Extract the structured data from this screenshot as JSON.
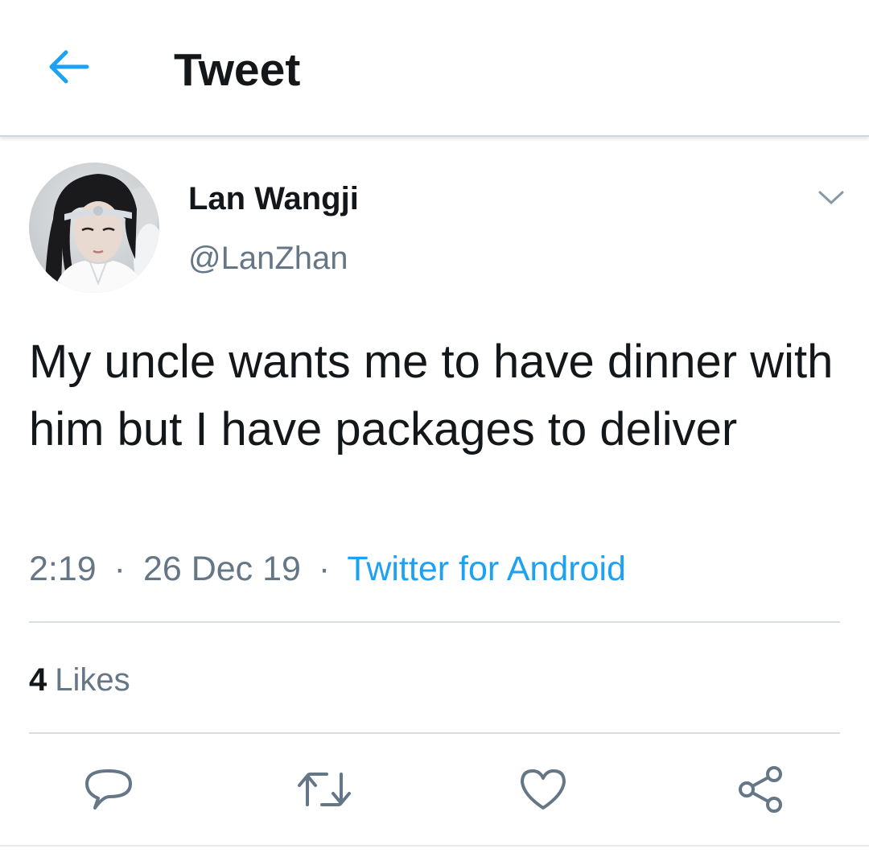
{
  "header": {
    "title": "Tweet",
    "back_icon": "arrow-left-icon"
  },
  "author": {
    "name": "Lan Wangji",
    "handle": "@LanZhan"
  },
  "tweet": {
    "text": "My uncle wants me to have dinner with him but I have packages to deliver",
    "time": "2:19",
    "separator": "·",
    "date": "26 Dec 19",
    "source": "Twitter for Android"
  },
  "stats": {
    "likes_count": "4",
    "likes_label": "Likes"
  },
  "actions": [
    "reply-icon",
    "retweet-icon",
    "like-icon",
    "share-icon"
  ],
  "colors": {
    "accent": "#1da1f2",
    "secondary_text": "#657786",
    "primary_text": "#14171a",
    "divider": "#d8dde1"
  }
}
